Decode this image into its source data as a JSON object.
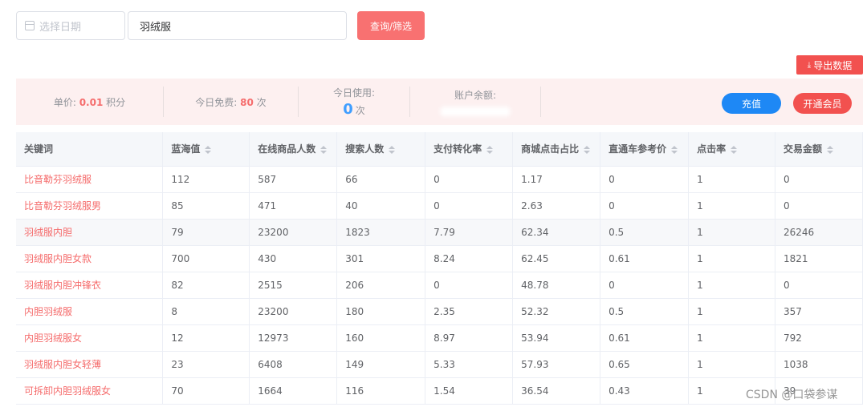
{
  "filters": {
    "date_placeholder": "选择日期",
    "keyword_value": "羽绒服",
    "query_label": "查询/筛选"
  },
  "export_label": "导出数据",
  "stats": {
    "unit_price_label": "单价: ",
    "unit_price_value": "0.01",
    "unit_price_unit": " 积分",
    "free_today_label": "今日免费: ",
    "free_today_value": "80",
    "free_today_unit": " 次",
    "used_today_label": "今日使用:",
    "used_today_value": "0",
    "used_today_unit": "次",
    "balance_label": "账户余额:"
  },
  "actions": {
    "recharge_label": "充值",
    "vip_label": "开通会员"
  },
  "table": {
    "columns": [
      "关键词",
      "蓝海值",
      "在线商品人数",
      "搜索人数",
      "支付转化率",
      "商城点击占比",
      "直通车参考价",
      "点击率",
      "交易金额"
    ],
    "rows": [
      [
        "比音勒芬羽绒服",
        "112",
        "587",
        "66",
        "0",
        "1.17",
        "0",
        "1",
        "0"
      ],
      [
        "比音勒芬羽绒服男",
        "85",
        "471",
        "40",
        "0",
        "2.63",
        "0",
        "1",
        "0"
      ],
      [
        "羽绒服内胆",
        "79",
        "23200",
        "1823",
        "7.79",
        "62.34",
        "0.5",
        "1",
        "26246"
      ],
      [
        "羽绒服内胆女款",
        "700",
        "430",
        "301",
        "8.24",
        "62.45",
        "0.61",
        "1",
        "1821"
      ],
      [
        "羽绒服内胆冲锋衣",
        "82",
        "2515",
        "206",
        "0",
        "48.78",
        "0",
        "1",
        "0"
      ],
      [
        "内胆羽绒服",
        "8",
        "23200",
        "180",
        "2.35",
        "52.32",
        "0.5",
        "1",
        "357"
      ],
      [
        "内胆羽绒服女",
        "12",
        "12973",
        "160",
        "8.97",
        "53.94",
        "0.61",
        "1",
        "792"
      ],
      [
        "羽绒服内胆女轻薄",
        "23",
        "6408",
        "149",
        "5.33",
        "57.93",
        "0.65",
        "1",
        "1038"
      ],
      [
        "可拆卸内胆羽绒服女",
        "70",
        "1664",
        "116",
        "1.54",
        "36.54",
        "0.43",
        "1",
        "39"
      ]
    ]
  },
  "watermark": "CSDN @口袋参谋",
  "colors": {
    "accent_red": "#f56c6c",
    "query_button": "#f87171",
    "export_button": "#f2514f",
    "recharge_button": "#1e88f5",
    "stats_bg": "#fdf0f0"
  }
}
